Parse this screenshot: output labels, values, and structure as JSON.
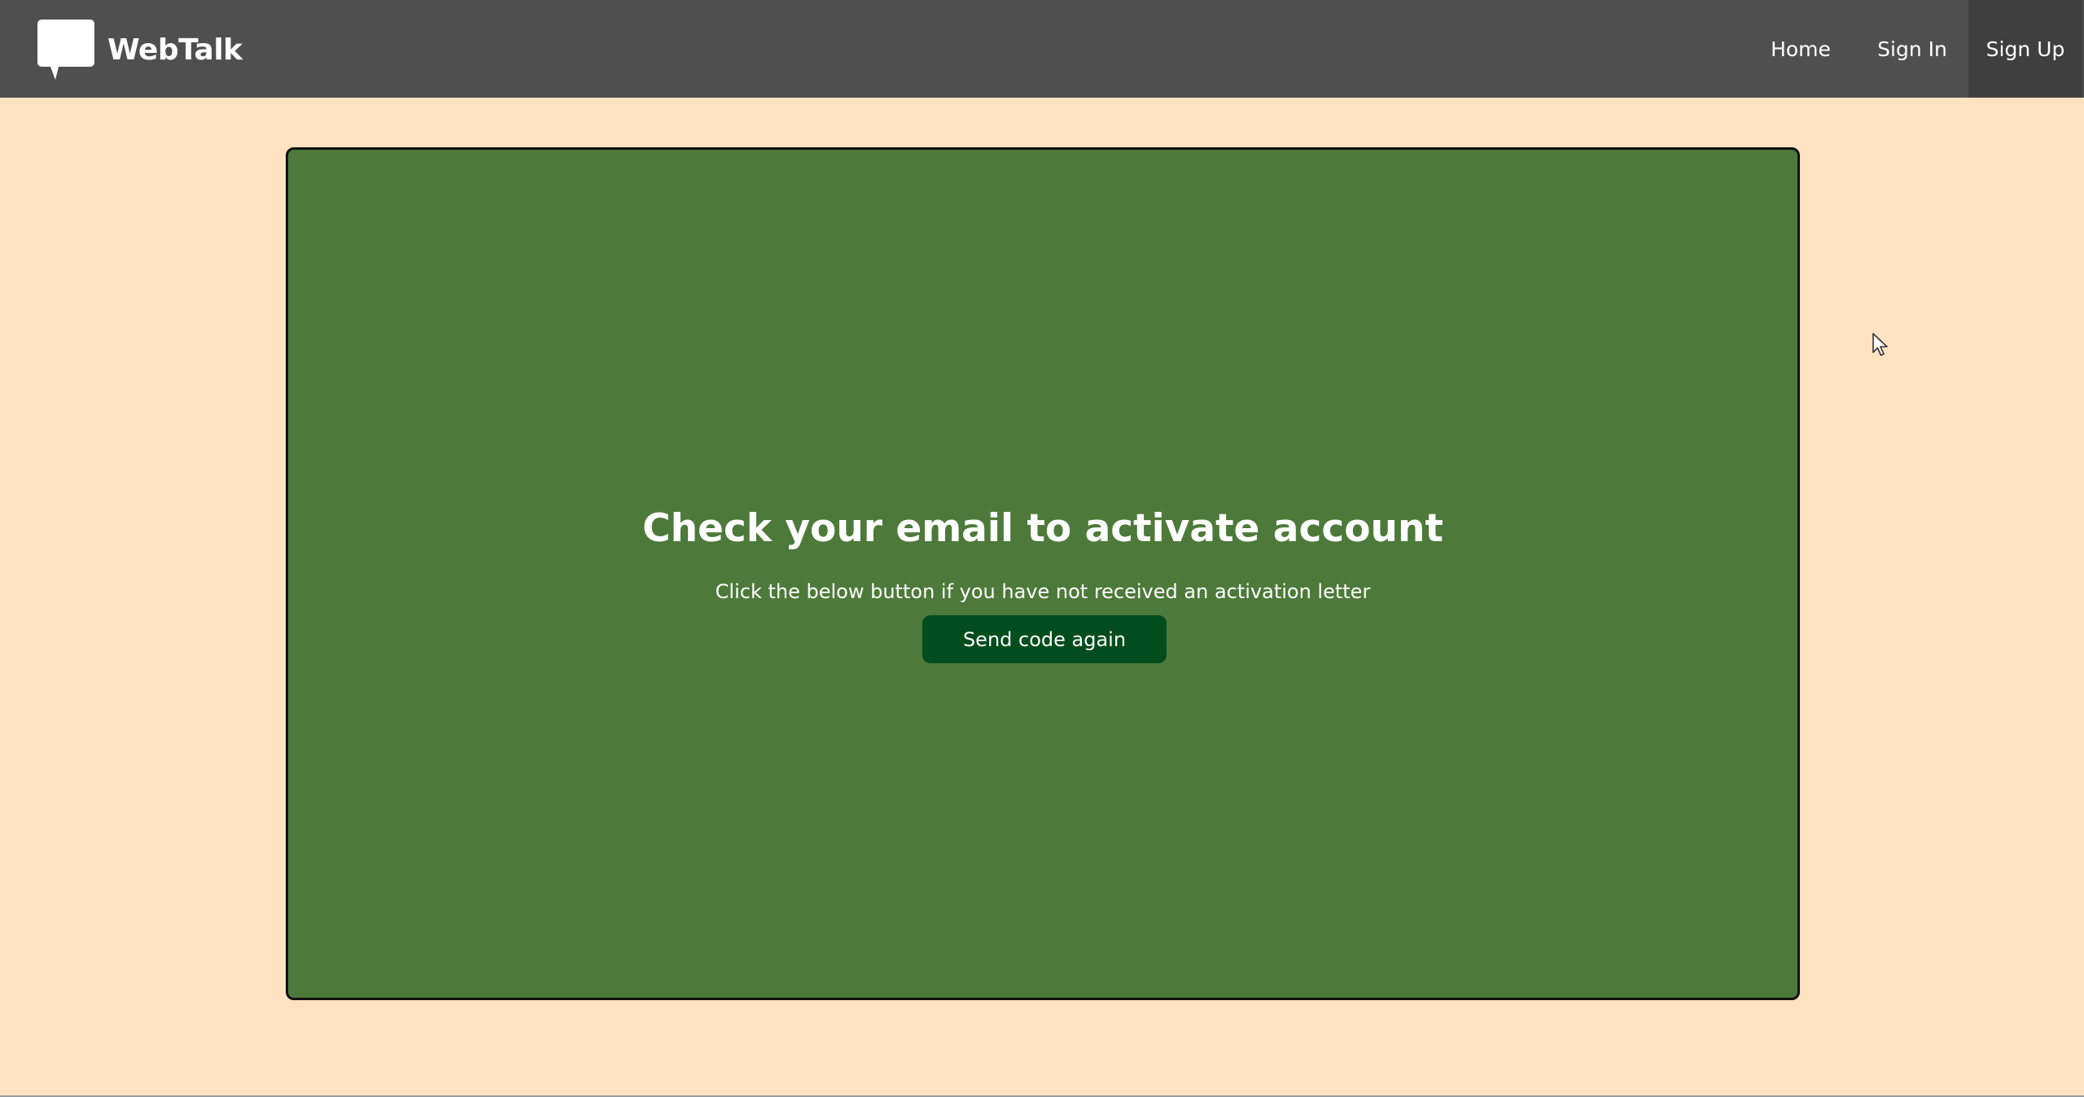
{
  "navbar": {
    "brand": {
      "name": "WebTalk",
      "icon": "speech-bubble-icon"
    },
    "links": {
      "home": "Home",
      "sign_in": "Sign In",
      "sign_up": "Sign Up"
    }
  },
  "main": {
    "headline": "Check your email to activate account",
    "subtext": "Click the below button if you have not received an activation letter",
    "button_label": "Send code again"
  },
  "colors": {
    "navbar": "#4f4f4f",
    "navbar_active": "#3f3f3f",
    "page_background": "#ffe2c2",
    "card_background": "#4d7a3a",
    "button_background": "#024d1d",
    "text": "#ffffff"
  }
}
